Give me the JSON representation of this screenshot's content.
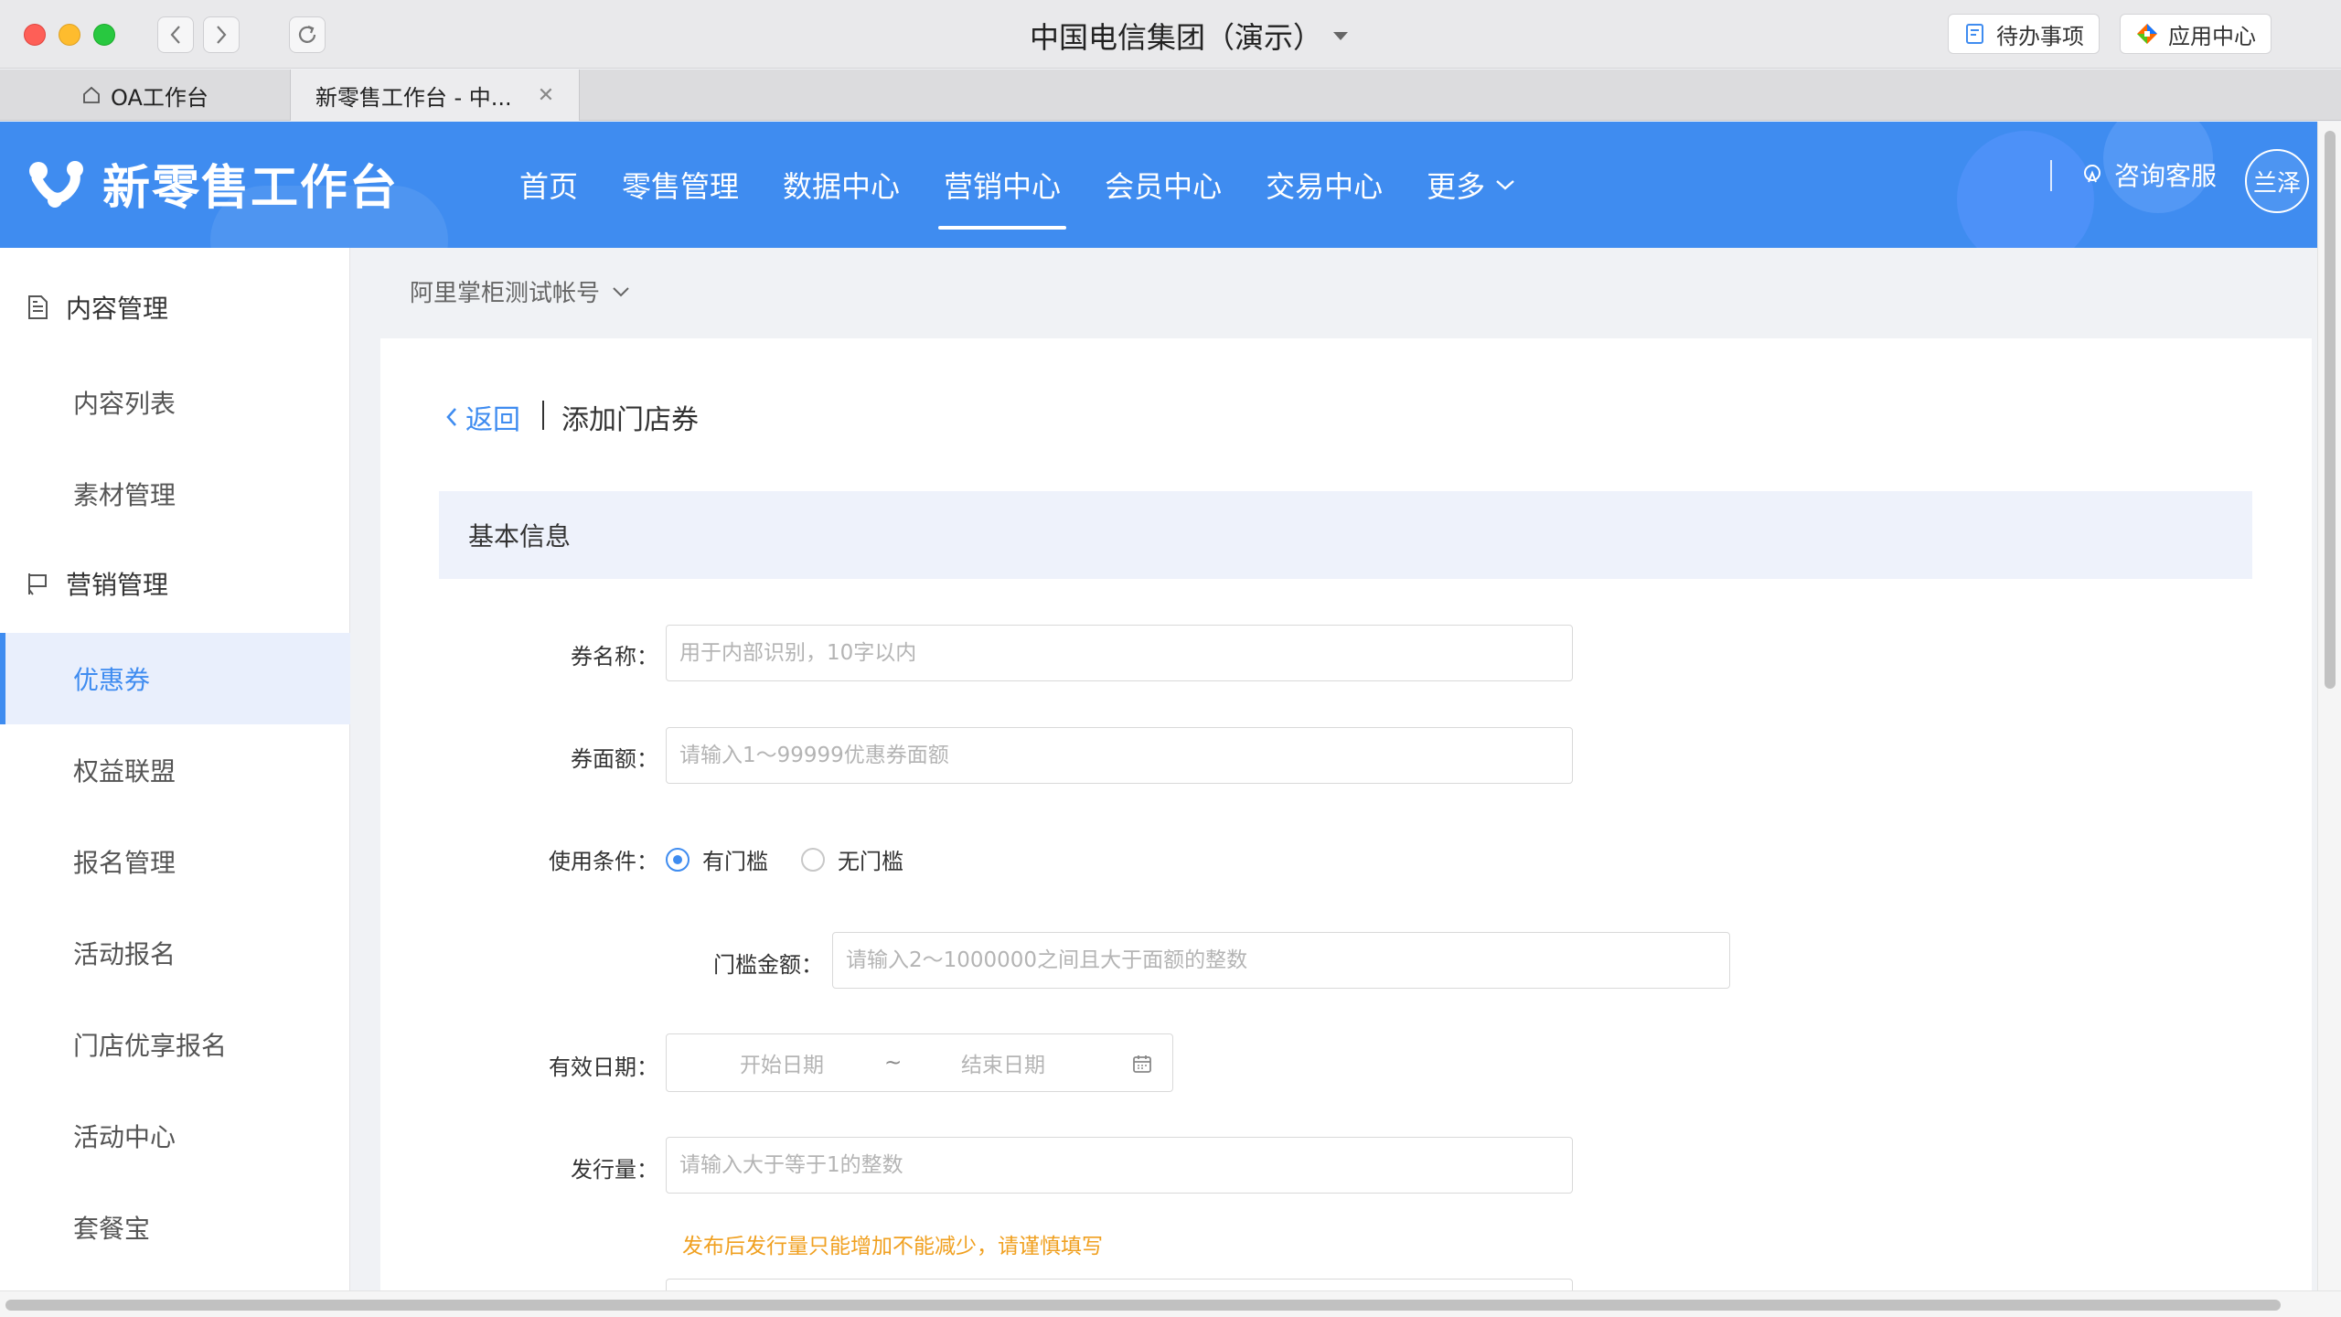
{
  "window": {
    "title": "中国电信集团（演示）",
    "todo_label": "待办事项",
    "appcenter_label": "应用中心"
  },
  "tabs": [
    {
      "label": "OA工作台"
    },
    {
      "label": "新零售工作台 - 中..."
    }
  ],
  "header": {
    "logo_text": "新零售工作台",
    "nav": [
      {
        "label": "首页"
      },
      {
        "label": "零售管理"
      },
      {
        "label": "数据中心"
      },
      {
        "label": "营销中心",
        "active": true
      },
      {
        "label": "会员中心"
      },
      {
        "label": "交易中心"
      },
      {
        "label": "更多"
      }
    ],
    "service_label": "咨询客服",
    "avatar_text": "兰泽"
  },
  "sidebar": {
    "groups": [
      {
        "label": "内容管理",
        "icon": "document-icon"
      },
      {
        "label": "营销管理",
        "icon": "flag-icon"
      }
    ],
    "items": [
      {
        "label": "内容列表"
      },
      {
        "label": "素材管理"
      },
      {
        "label": "优惠券",
        "active": true
      },
      {
        "label": "权益联盟"
      },
      {
        "label": "报名管理"
      },
      {
        "label": "活动报名"
      },
      {
        "label": "门店优享报名"
      },
      {
        "label": "活动中心"
      },
      {
        "label": "套餐宝"
      }
    ]
  },
  "content": {
    "account": "阿里掌柜测试帐号",
    "back_label": "返回",
    "page_title": "添加门店券",
    "section_title": "基本信息",
    "form": {
      "name_label": "券名称：",
      "name_placeholder": "用于内部识别，10字以内",
      "amount_label": "券面额：",
      "amount_placeholder": "请输入1～99999优惠券面额",
      "condition_label": "使用条件：",
      "condition_options": [
        {
          "label": "有门槛",
          "checked": true
        },
        {
          "label": "无门槛",
          "checked": false
        }
      ],
      "threshold_label": "门槛金额：",
      "threshold_placeholder": "请输入2～1000000之间且大于面额的整数",
      "date_label": "有效日期：",
      "date_start": "开始日期",
      "date_sep": "~",
      "date_end": "结束日期",
      "quantity_label": "发行量：",
      "quantity_placeholder": "请输入大于等于1的整数",
      "quantity_hint": "发布后发行量只能增加不能减少，请谨慎填写"
    }
  },
  "colors": {
    "primary": "#3f8cf0",
    "hint": "#f0a020"
  }
}
